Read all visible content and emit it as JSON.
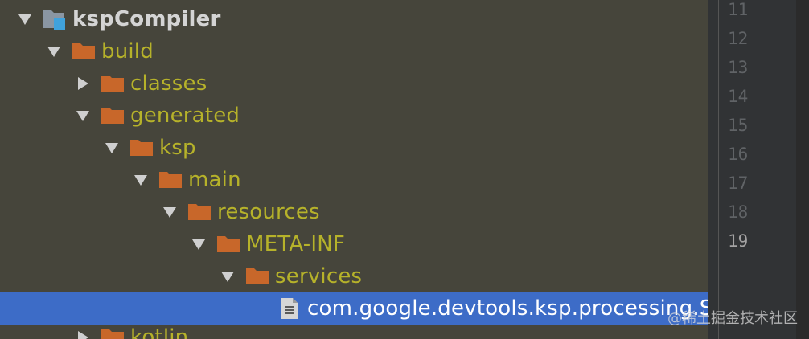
{
  "tree": {
    "rows": [
      {
        "label": "ksp​Compiler",
        "kind": "module",
        "expanded": true
      },
      {
        "label": "build",
        "kind": "folder",
        "expanded": true
      },
      {
        "label": "classes",
        "kind": "folder",
        "expanded": false
      },
      {
        "label": "generated",
        "kind": "folder",
        "expanded": true
      },
      {
        "label": "ksp",
        "kind": "folder",
        "expanded": true
      },
      {
        "label": "main",
        "kind": "folder",
        "expanded": true
      },
      {
        "label": "resources",
        "kind": "folder",
        "expanded": true
      },
      {
        "label": "META-INF",
        "kind": "folder",
        "expanded": true
      },
      {
        "label": "services",
        "kind": "folder",
        "expanded": true
      },
      {
        "label": "com.google.devtools.ksp.processing.Sy",
        "kind": "file",
        "selected": true
      },
      {
        "label": "kotlin",
        "kind": "folder",
        "expanded": false
      }
    ]
  },
  "gutter": {
    "line_numbers": [
      "11",
      "12",
      "13",
      "14",
      "15",
      "16",
      "17",
      "18",
      "19"
    ],
    "current_line": "19"
  },
  "watermark": "@稀土掘金技术社区",
  "colors": {
    "panel_bg": "#46453b",
    "folder_text": "#b6b22a",
    "folder_icon": "#c8672a",
    "selection": "#3d6cc7",
    "gutter_bg": "#313335"
  }
}
